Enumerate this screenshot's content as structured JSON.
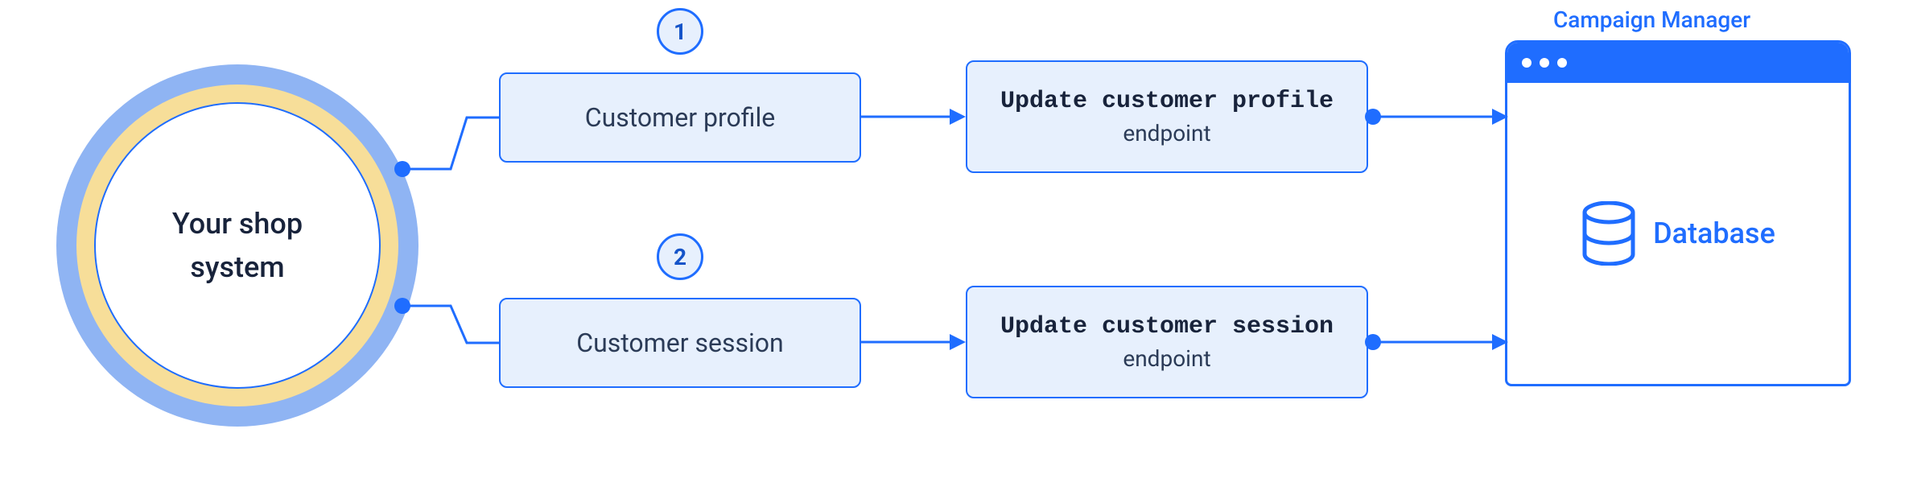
{
  "source": {
    "label_line1": "Your shop",
    "label_line2": "system"
  },
  "steps": {
    "badge1": "1",
    "badge2": "2",
    "box1": "Customer profile",
    "box2": "Customer session"
  },
  "endpoints": {
    "title1": "Update customer profile",
    "title2": "Update customer session",
    "sub": "endpoint"
  },
  "target": {
    "title": "Campaign Manager",
    "db_label": "Database"
  }
}
